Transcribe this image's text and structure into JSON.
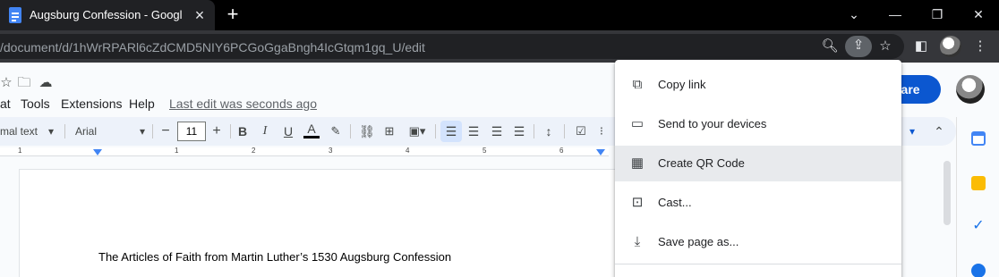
{
  "browser": {
    "tab_title": "Augsburg Confession - Google Docs",
    "url": "/document/d/1hWrRPARl6cZdCMD5NIY6PCGoGgaBngh4IcGtqm1gq_U/edit"
  },
  "docs": {
    "menu": [
      "at",
      "Tools",
      "Extensions",
      "Help"
    ],
    "last_edit": "Last edit was seconds ago",
    "share_label": "hare",
    "toolbar": {
      "style": "mal text",
      "font": "Arial",
      "font_size": "11"
    },
    "ruler_numbers": [
      "1",
      "1",
      "2",
      "3",
      "4",
      "5",
      "6"
    ],
    "body_text": "The Articles of Faith from Martin Luther’s 1530 Augsburg Confession"
  },
  "share_menu": {
    "items": [
      {
        "label": "Copy link",
        "icon": "copy-icon"
      },
      {
        "label": "Send to your devices",
        "icon": "devices-icon"
      },
      {
        "label": "Create QR Code",
        "icon": "qr-code-icon",
        "highlighted": true
      },
      {
        "label": "Cast...",
        "icon": "cast-icon"
      },
      {
        "label": "Save page as...",
        "icon": "save-page-icon"
      }
    ]
  },
  "colors": {
    "share_button": "#0b57d0",
    "highlight": "#e8eaed",
    "tab_bg": "#202124"
  }
}
